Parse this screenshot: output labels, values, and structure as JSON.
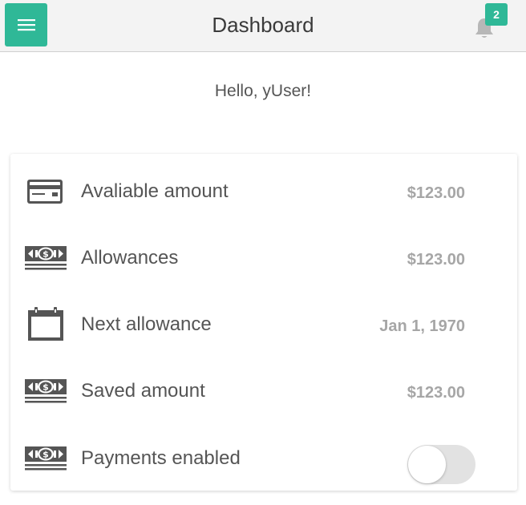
{
  "header": {
    "title": "Dashboard",
    "notification_count": "2",
    "accent_color": "#2fb897"
  },
  "greeting": "Hello, yUser!",
  "rows": [
    {
      "icon": "credit-card-icon",
      "label": "Avaliable amount",
      "value": "$123.00"
    },
    {
      "icon": "money-stack-icon",
      "label": "Allowances",
      "value": "$123.00"
    },
    {
      "icon": "calendar-icon",
      "label": "Next allowance",
      "value": "Jan 1, 1970"
    },
    {
      "icon": "money-stack-icon",
      "label": "Saved amount",
      "value": "$123.00"
    },
    {
      "icon": "money-stack-icon",
      "label": "Payments enabled",
      "toggle_on": false
    }
  ]
}
